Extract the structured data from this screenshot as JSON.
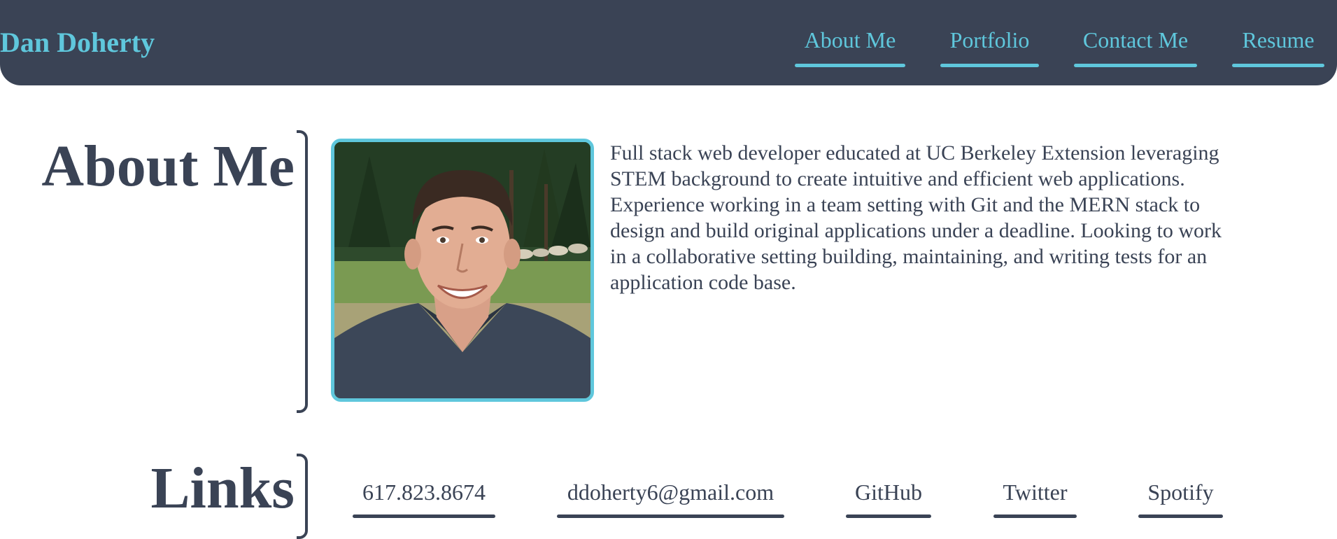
{
  "header": {
    "brand": "Dan Doherty",
    "nav": [
      {
        "label": "About Me"
      },
      {
        "label": "Portfolio"
      },
      {
        "label": "Contact Me"
      },
      {
        "label": "Resume"
      }
    ]
  },
  "about": {
    "title": "About Me",
    "photo_alt": "Portrait of Dan Doherty",
    "text": "Full stack web developer educated at UC Berkeley Extension leveraging STEM background to create intuitive and efficient web applications. Experience working in a team setting with Git and the MERN stack to design and build original applications under a deadline. Looking to work in a collaborative setting building, maintaining, and writing tests for an application code base."
  },
  "links": {
    "title": "Links",
    "items": [
      {
        "label": "617.823.8674"
      },
      {
        "label": "ddoherty6@gmail.com"
      },
      {
        "label": "GitHub"
      },
      {
        "label": "Twitter"
      },
      {
        "label": "Spotify"
      }
    ]
  },
  "colors": {
    "navy": "#3a4355",
    "accent": "#5fc7dc",
    "background": "#ffffff"
  }
}
